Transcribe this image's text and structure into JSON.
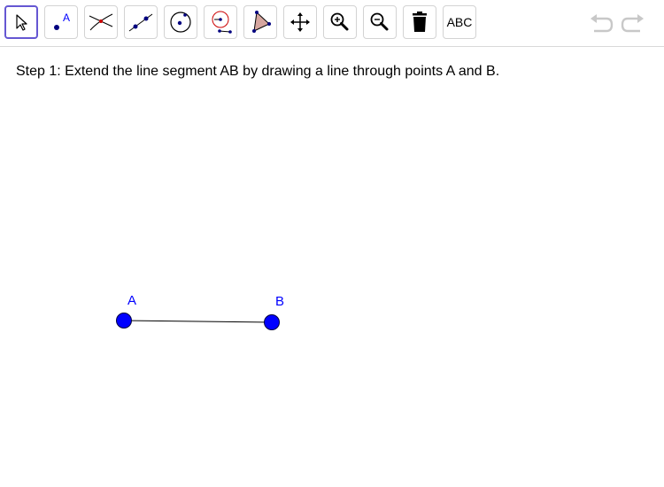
{
  "toolbar": {
    "tools": [
      {
        "name": "move",
        "icon": "arrow-cursor-icon"
      },
      {
        "name": "point",
        "icon": "point-icon",
        "icon_text": "A"
      },
      {
        "name": "intersect",
        "icon": "intersect-icon"
      },
      {
        "name": "line",
        "icon": "line-through-two-points-icon"
      },
      {
        "name": "circle",
        "icon": "circle-center-point-icon"
      },
      {
        "name": "compass",
        "icon": "compass-icon"
      },
      {
        "name": "polygon",
        "icon": "polygon-icon"
      },
      {
        "name": "move-graphics",
        "icon": "move-graphics-icon"
      },
      {
        "name": "zoom-in",
        "icon": "zoom-in-icon"
      },
      {
        "name": "zoom-out",
        "icon": "zoom-out-icon"
      },
      {
        "name": "delete",
        "icon": "trash-icon"
      },
      {
        "name": "text",
        "icon": "text-icon",
        "label": "ABC"
      }
    ],
    "selected_tool": "move",
    "undo_icon": "undo-icon",
    "redo_icon": "redo-icon"
  },
  "instruction": "Step 1: Extend the line segment AB by drawing a line through points A and B.",
  "points": [
    {
      "label": "A",
      "color": "#0000ff"
    },
    {
      "label": "B",
      "color": "#0000ff"
    }
  ],
  "segment": {
    "from": "A",
    "to": "B",
    "color": "#000000"
  },
  "colors": {
    "selected_border": "#6557d2",
    "point_fill": "#0000ff",
    "point_label": "#0000ff",
    "polygon_fill": "#d6a69f",
    "compass_red": "#cc0000",
    "disabled_icon": "#c8c8c8"
  }
}
